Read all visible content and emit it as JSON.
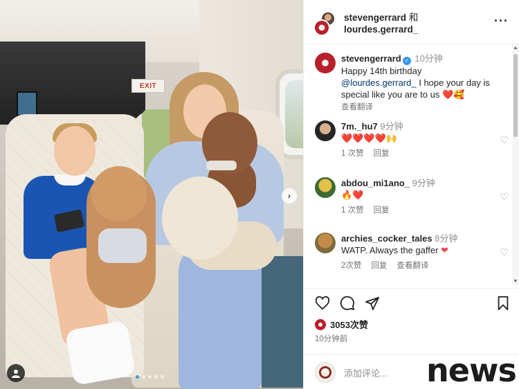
{
  "photo": {
    "exit_sign": "EXIT",
    "carousel_dots": 5,
    "carousel_active_index": 0
  },
  "header": {
    "user1": "stevengerrard",
    "conjunction": "和",
    "user2": "lourdes.gerrard_",
    "more_icon": "more-horizontal-icon"
  },
  "caption": {
    "username": "stevengerrard",
    "time": "10分钟",
    "line1": "Happy 14th birthday",
    "mention": "@lourdes.gerrard_",
    "rest": "I hope your day is special like you are to us",
    "emoji": "❤️🥰",
    "translate": "查看翻译"
  },
  "comments": [
    {
      "username": "7m._hu7",
      "time": "9分钟",
      "text": "❤️❤️❤️❤️🙌",
      "likes": "1 次赞",
      "reply": "回复",
      "translate": ""
    },
    {
      "username": "abdou_mi1ano_",
      "time": "9分钟",
      "text": "🔥❤️",
      "likes": "1 次赞",
      "reply": "回复",
      "translate": ""
    },
    {
      "username": "archies_cocker_tales",
      "time": "8分钟",
      "text": "WATP. Always the gaffer",
      "likes": "2次赞",
      "reply": "回复",
      "translate": "查看翻译"
    }
  ],
  "actions": {
    "likes_count": "3053次赞",
    "posted": "10分钟前"
  },
  "add_comment": {
    "placeholder": "添加评论..."
  },
  "watermark": "news",
  "colors": {
    "verified": "#3897f0",
    "heart": "#ed4956",
    "link": "#00376b"
  }
}
